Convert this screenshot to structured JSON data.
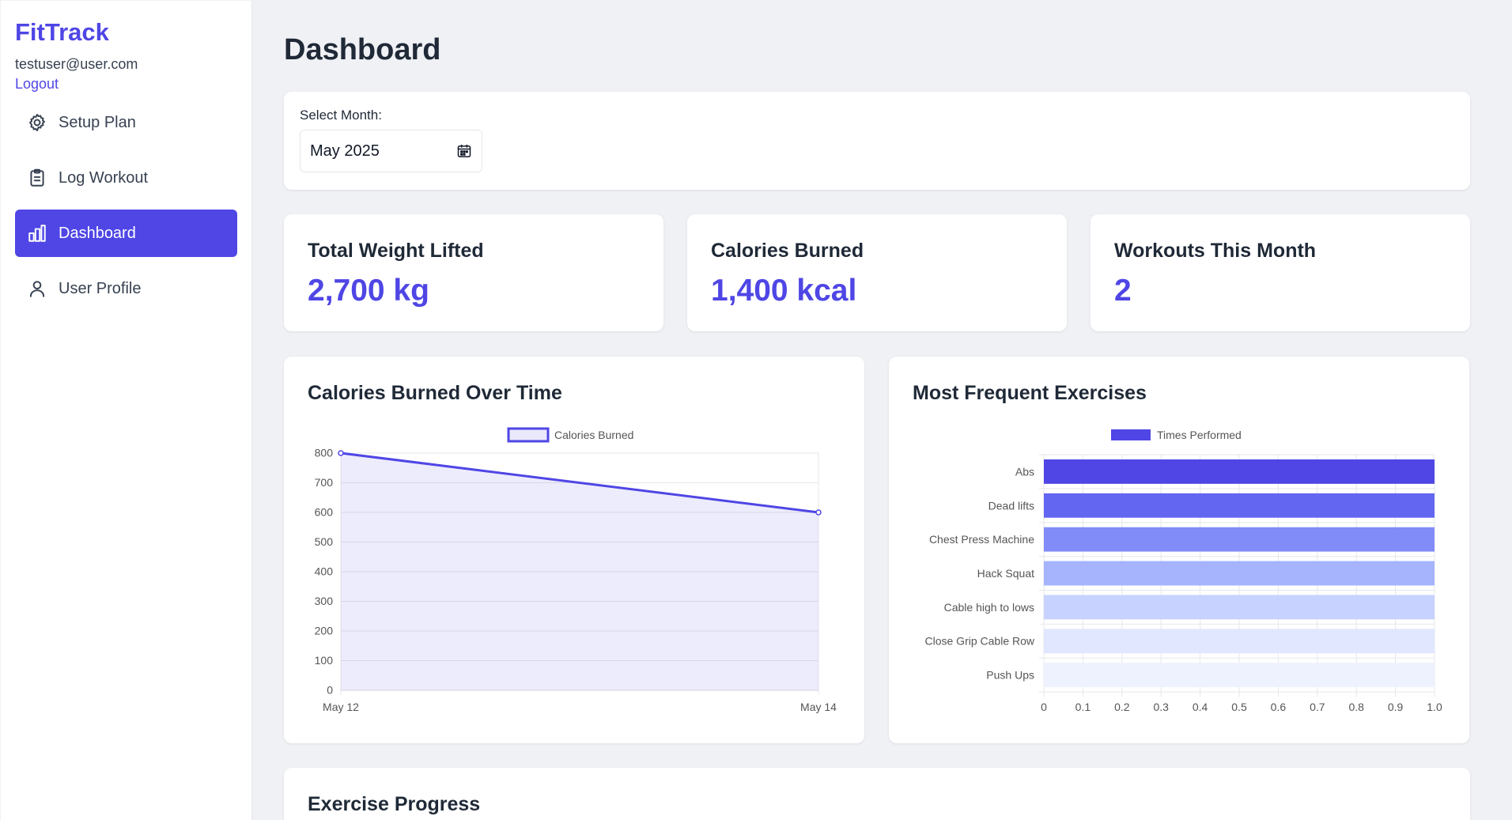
{
  "sidebar": {
    "brand": "FitTrack",
    "email": "testuser@user.com",
    "logout": "Logout",
    "items": [
      {
        "label": "Setup Plan",
        "icon": "gear-icon",
        "active": false
      },
      {
        "label": "Log Workout",
        "icon": "clipboard-icon",
        "active": false
      },
      {
        "label": "Dashboard",
        "icon": "bar-chart-icon",
        "active": true
      },
      {
        "label": "User Profile",
        "icon": "user-icon",
        "active": false
      }
    ]
  },
  "main": {
    "title": "Dashboard",
    "month_label": "Select Month:",
    "month_value": "May  2025",
    "stats": [
      {
        "title": "Total Weight Lifted",
        "value": "2,700 kg"
      },
      {
        "title": "Calories Burned",
        "value": "1,400 kcal"
      },
      {
        "title": "Workouts This Month",
        "value": "2"
      }
    ],
    "progress_title": "Exercise Progress"
  },
  "colors": {
    "accent": "#4f46e5",
    "background": "#f0f1f5"
  },
  "chart_data": [
    {
      "type": "area",
      "title": "Calories Burned Over Time",
      "categories": [
        "May 12",
        "May 14"
      ],
      "series": [
        {
          "name": "Calories Burned",
          "values": [
            800,
            600
          ]
        }
      ],
      "yticks": [
        "0",
        "100",
        "200",
        "300",
        "400",
        "500",
        "600",
        "700",
        "800"
      ],
      "ylim": [
        0,
        800
      ],
      "legend": "top-center",
      "grid": true
    },
    {
      "type": "bar",
      "orientation": "horizontal",
      "title": "Most Frequent Exercises",
      "categories": [
        "Abs",
        "Dead lifts",
        "Chest Press Machine",
        "Hack Squat",
        "Cable high to lows",
        "Close Grip Cable Row",
        "Push Ups"
      ],
      "series": [
        {
          "name": "Times Performed",
          "values": [
            1,
            1,
            1,
            1,
            1,
            1,
            1
          ]
        }
      ],
      "bar_colors": [
        "#4f46e5",
        "#6366f1",
        "#818cf8",
        "#a5b4fc",
        "#c7d2fe",
        "#e0e7ff",
        "#eef2ff"
      ],
      "xticks": [
        "0",
        "0.1",
        "0.2",
        "0.3",
        "0.4",
        "0.5",
        "0.6",
        "0.7",
        "0.8",
        "0.9",
        "1.0"
      ],
      "xlim": [
        0,
        1
      ],
      "legend": "top-center",
      "grid": true
    }
  ]
}
